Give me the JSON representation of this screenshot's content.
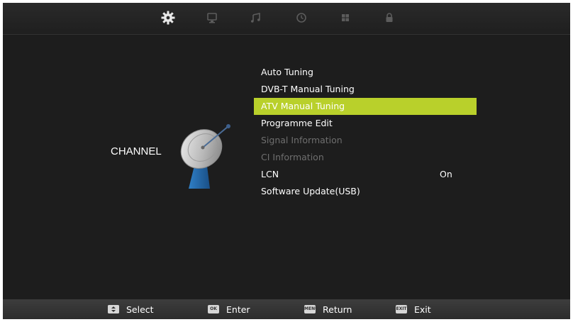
{
  "topbar": {
    "tabs": [
      {
        "icon": "gear-icon",
        "label": ""
      },
      {
        "icon": "monitor-icon",
        "label": ""
      },
      {
        "icon": "music-icon",
        "label": ""
      },
      {
        "icon": "clock-icon",
        "label": ""
      },
      {
        "icon": "grid-icon",
        "label": ""
      },
      {
        "icon": "lock-icon",
        "label": ""
      }
    ],
    "active_tab": "gear-icon"
  },
  "category": {
    "label": "CHANNEL",
    "icon": "satellite-dish-icon"
  },
  "menu": {
    "items": [
      {
        "label": "Auto Tuning",
        "state": "enabled"
      },
      {
        "label": "DVB-T Manual Tuning",
        "state": "enabled"
      },
      {
        "label": "ATV Manual Tuning",
        "state": "selected"
      },
      {
        "label": "Programme Edit",
        "state": "enabled"
      },
      {
        "label": "Signal Information",
        "state": "disabled"
      },
      {
        "label": "CI Information",
        "state": "disabled"
      },
      {
        "label": "LCN",
        "state": "enabled",
        "value": "On"
      },
      {
        "label": "Software Update(USB)",
        "state": "enabled"
      }
    ]
  },
  "footer": {
    "select": {
      "key": "",
      "label": "Select"
    },
    "enter": {
      "key": "OK",
      "label": "Enter"
    },
    "return": {
      "key": "MENU",
      "label": "Return"
    },
    "exit": {
      "key": "EXIT",
      "label": "Exit"
    }
  },
  "colors": {
    "highlight": "#b9d02b",
    "background": "#1d1d1d",
    "disabled_text": "#6e6e6e"
  }
}
